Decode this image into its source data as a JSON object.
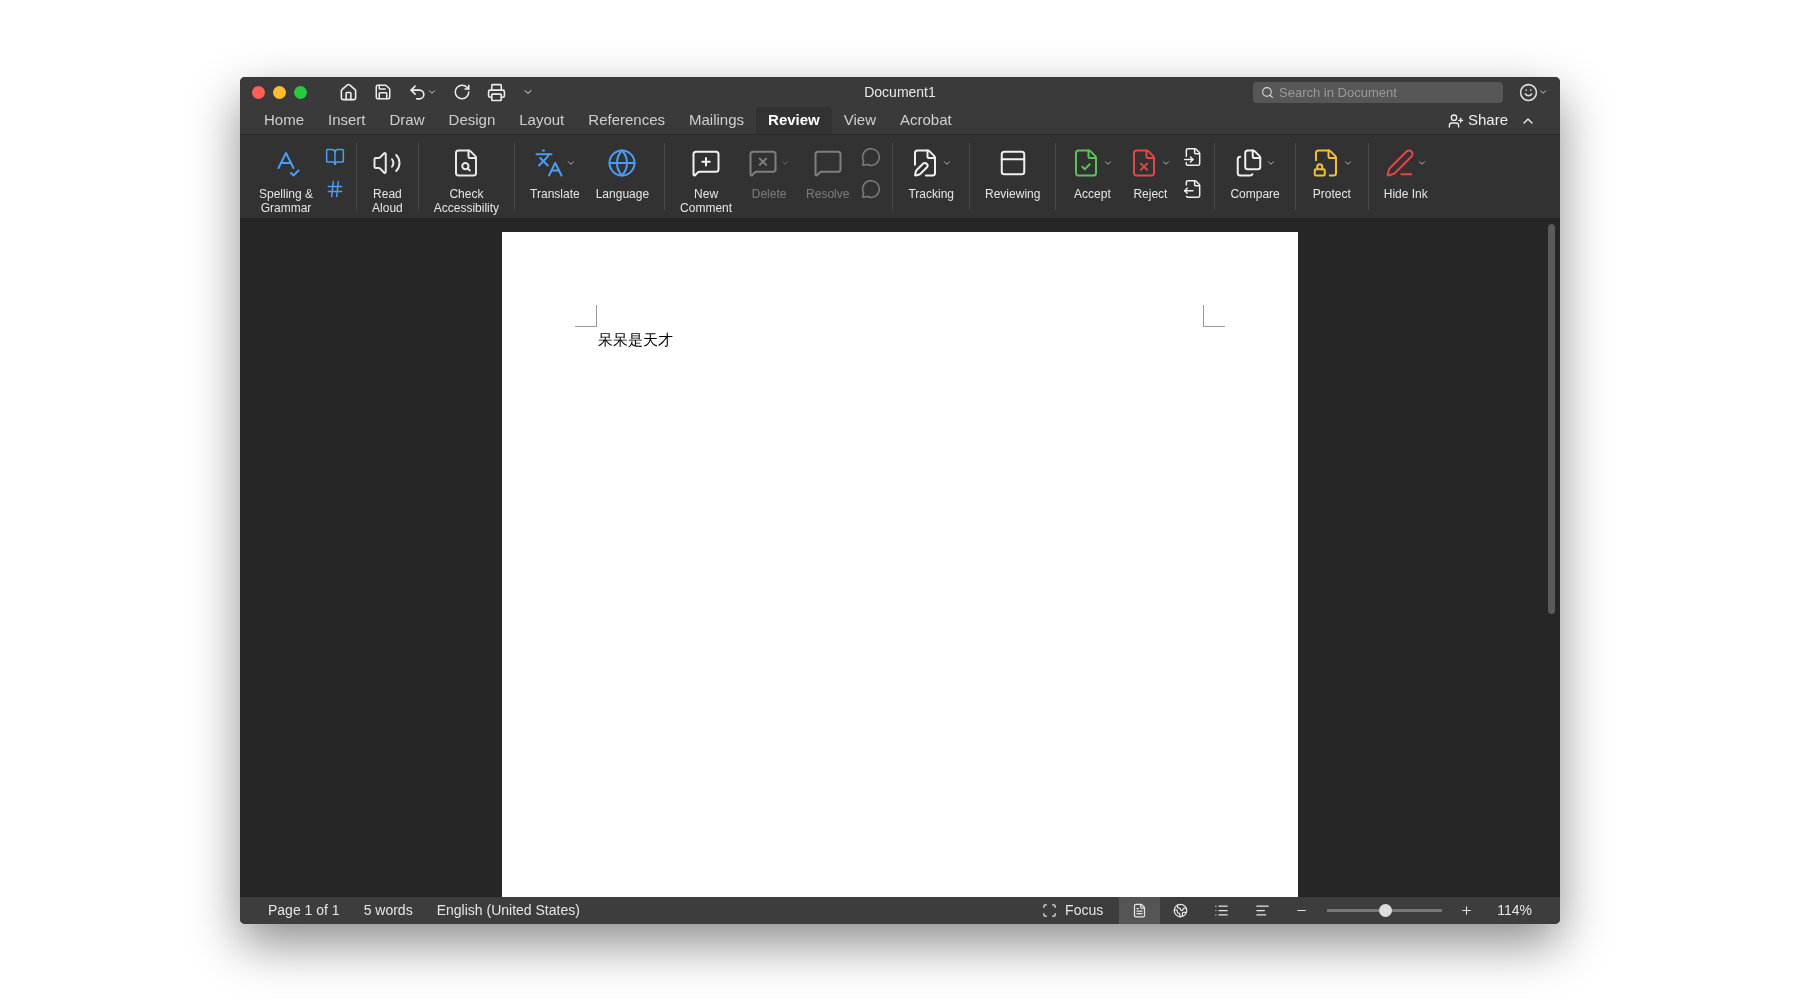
{
  "window": {
    "title": "Document1"
  },
  "search": {
    "placeholder": "Search in Document"
  },
  "tabs": [
    {
      "label": "Home",
      "selected": false
    },
    {
      "label": "Insert",
      "selected": false
    },
    {
      "label": "Draw",
      "selected": false
    },
    {
      "label": "Design",
      "selected": false
    },
    {
      "label": "Layout",
      "selected": false
    },
    {
      "label": "References",
      "selected": false
    },
    {
      "label": "Mailings",
      "selected": false
    },
    {
      "label": "Review",
      "selected": true
    },
    {
      "label": "View",
      "selected": false
    },
    {
      "label": "Acrobat",
      "selected": false
    }
  ],
  "share": {
    "label": "Share"
  },
  "ribbon": [
    {
      "items": [
        {
          "kind": "large",
          "label": "Spelling &\nGrammar",
          "disabled": false,
          "dropdown": false
        },
        {
          "kind": "stack",
          "disabled": false
        }
      ]
    },
    {
      "items": [
        {
          "kind": "large",
          "label": "Read\nAloud",
          "disabled": false,
          "dropdown": false
        }
      ]
    },
    {
      "items": [
        {
          "kind": "large",
          "label": "Check\nAccessibility",
          "disabled": false,
          "dropdown": false
        }
      ]
    },
    {
      "items": [
        {
          "kind": "large",
          "label": "Translate",
          "disabled": false,
          "dropdown": true
        },
        {
          "kind": "large",
          "label": "Language",
          "disabled": false,
          "dropdown": false
        }
      ]
    },
    {
      "items": [
        {
          "kind": "large",
          "label": "New\nComment",
          "disabled": false,
          "dropdown": false
        },
        {
          "kind": "large",
          "label": "Delete",
          "disabled": true,
          "dropdown": true
        },
        {
          "kind": "large",
          "label": "Resolve",
          "disabled": true,
          "dropdown": false
        },
        {
          "kind": "stack",
          "disabled": true
        }
      ]
    },
    {
      "items": [
        {
          "kind": "large",
          "label": "Tracking",
          "disabled": false,
          "dropdown": true
        }
      ]
    },
    {
      "items": [
        {
          "kind": "large",
          "label": "Reviewing",
          "disabled": false,
          "dropdown": false
        }
      ]
    },
    {
      "items": [
        {
          "kind": "large",
          "label": "Accept",
          "disabled": false,
          "dropdown": true
        },
        {
          "kind": "large",
          "label": "Reject",
          "disabled": false,
          "dropdown": true
        },
        {
          "kind": "stack",
          "disabled": false
        }
      ]
    },
    {
      "items": [
        {
          "kind": "large",
          "label": "Compare",
          "disabled": false,
          "dropdown": true
        }
      ]
    },
    {
      "items": [
        {
          "kind": "large",
          "label": "Protect",
          "disabled": false,
          "dropdown": true
        }
      ]
    },
    {
      "items": [
        {
          "kind": "large",
          "label": "Hide Ink",
          "disabled": false,
          "dropdown": true
        }
      ]
    }
  ],
  "document": {
    "text": "呆呆是天才"
  },
  "status_bar": {
    "page": "Page 1 of 1",
    "words": "5 words",
    "language": "English (United States)",
    "focus": "Focus",
    "views": [
      {
        "selected": true
      },
      {
        "selected": false
      },
      {
        "selected": false
      },
      {
        "selected": false
      }
    ],
    "zoom": {
      "level": 0.51,
      "reading": "114%"
    }
  }
}
